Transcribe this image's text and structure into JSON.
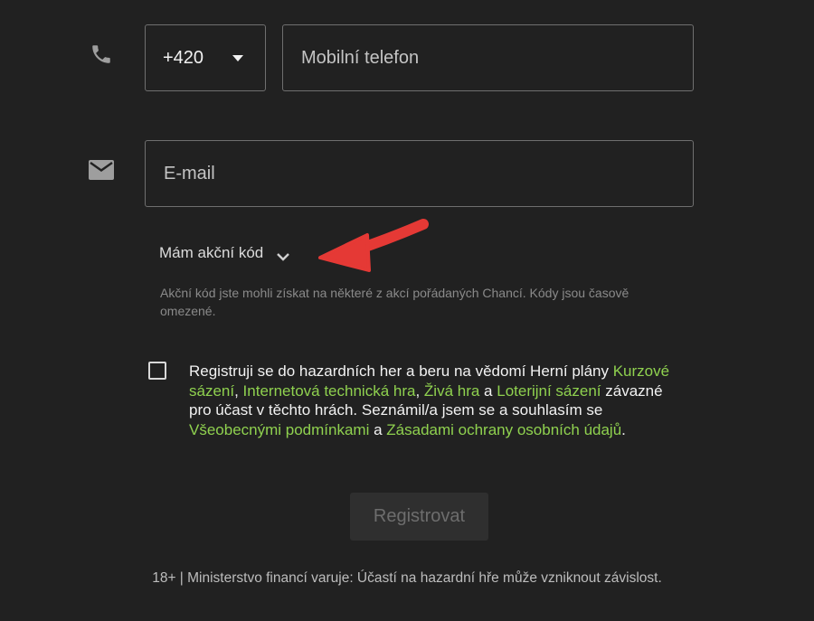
{
  "phone": {
    "icon": "phone-icon",
    "prefix_value": "+420",
    "placeholder": "Mobilní telefon"
  },
  "email": {
    "icon": "mail-icon",
    "placeholder": "E-mail"
  },
  "promo": {
    "toggle_label": "Mám akční kód",
    "hint": "Akční kód jste mohli získat na některé z akcí pořádaných Chancí. Kódy jsou časově omezené."
  },
  "consent": {
    "checked": false,
    "t1": "Registruji se do hazardních her a beru na vědomí Herní plány ",
    "link_kurzove": "Kurzové sázení",
    "t2": ", ",
    "link_internetova": "Internetová technická hra",
    "t3": ", ",
    "link_ziva": "Živá hra",
    "t4": " a ",
    "link_loterijni": "Loterijní sázení",
    "t5": " závazné pro účast v těchto hrách. Seznámil/a jsem se a souhlasím se ",
    "link_podminky": "Všeobecnými podmínkami",
    "t6": " a ",
    "link_zasady": "Zásadami ochrany osobních údajů",
    "t7": "."
  },
  "submit_label": "Registrovat",
  "footer": "18+ | Ministerstvo financí varuje: Účastí na hazardní hře může vzniknout závislost.",
  "colors": {
    "background": "#212121",
    "link": "#8fd14f",
    "annotation_arrow": "#e53935"
  }
}
